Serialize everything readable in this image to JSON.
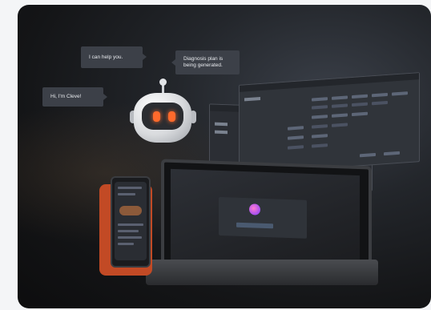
{
  "bubbles": {
    "help": "I can help you.",
    "diagnosis": "Diagnosis plan is being generated.",
    "greeting": "Hi, I'm Cleve!"
  },
  "colors": {
    "bubble_bg": "#3c4048",
    "robot_eye": "#ff6a2c",
    "phone_case": "#c24a25",
    "page_bg": "#f4f5f7"
  },
  "icons": {
    "robot": "robot-assistant-icon",
    "app_logo": "gradient-orb-logo-icon"
  }
}
